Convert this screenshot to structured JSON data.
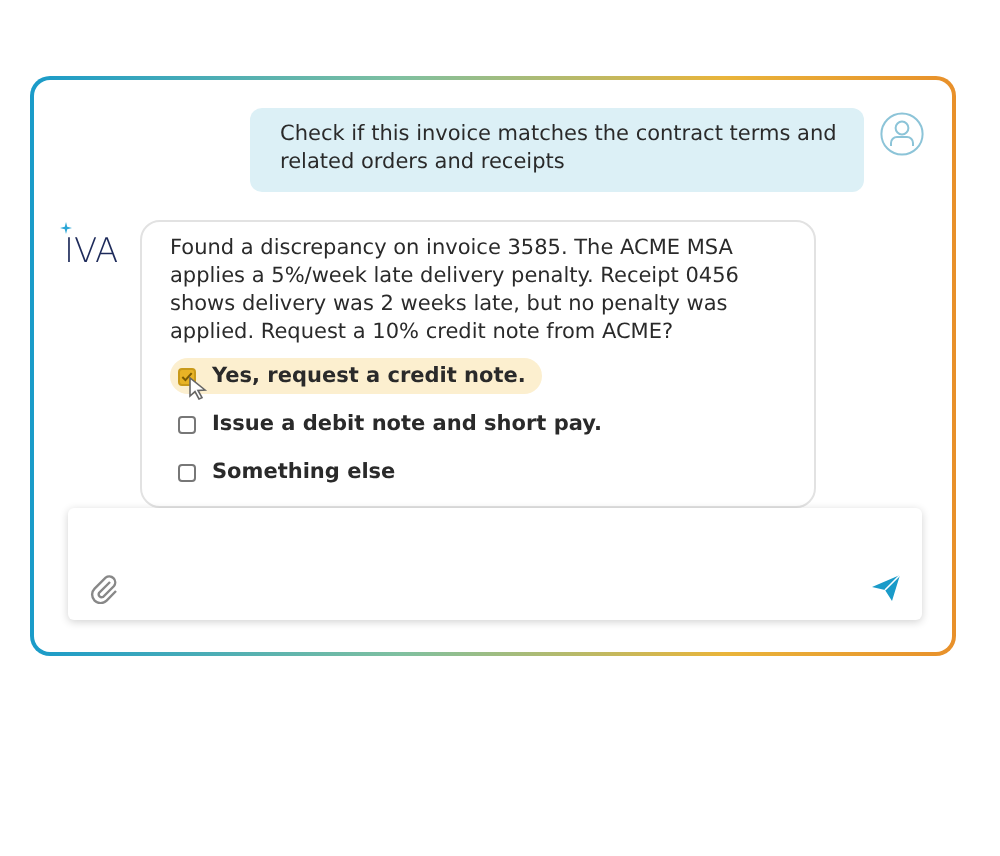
{
  "user_message": {
    "text": "Check if this invoice matches the contract terms and related orders and receipts"
  },
  "assistant": {
    "logo": "IVA",
    "message": "Found a discrepancy on invoice 3585. The ACME MSA applies a 5%/week late delivery penalty. Receipt 0456 shows delivery was 2 weeks late, but no penalty was applied. Request a 10% credit note from ACME?",
    "options": [
      {
        "label": "Yes, request a credit note.",
        "selected": true
      },
      {
        "label": "Issue a debit note and short pay.",
        "selected": false
      },
      {
        "label": "Something else",
        "selected": false
      }
    ]
  }
}
